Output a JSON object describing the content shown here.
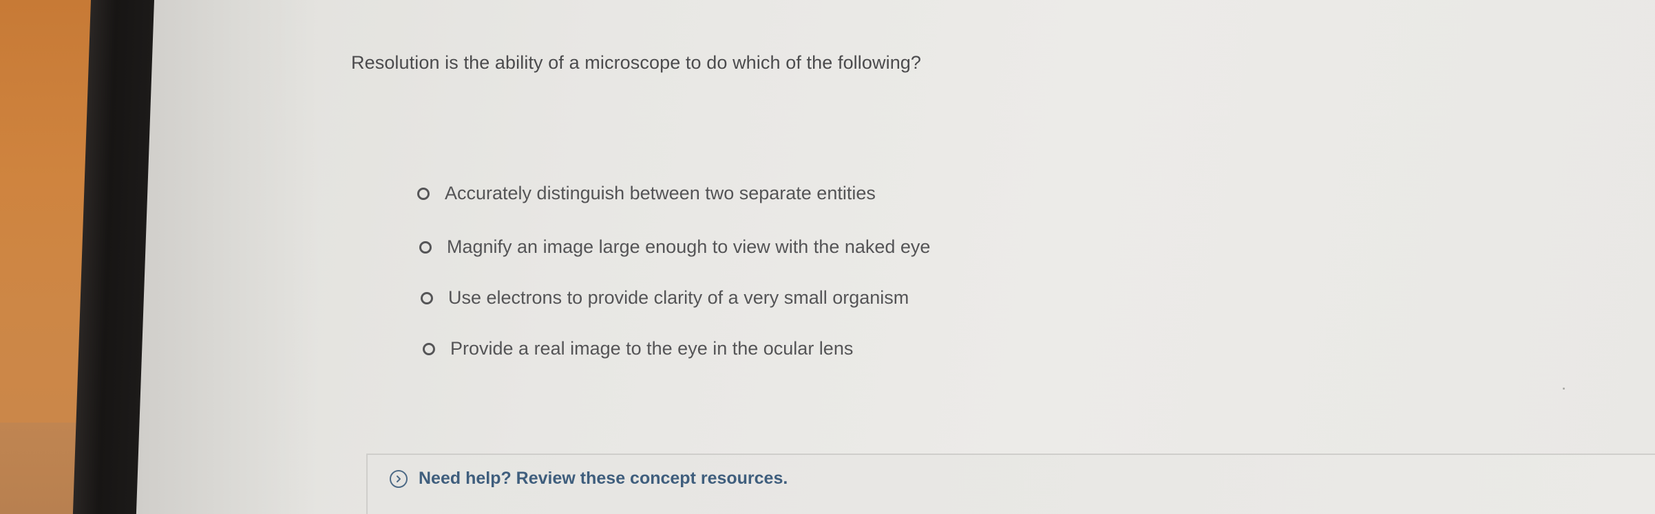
{
  "question": {
    "text": "Resolution is the ability of a microscope to do which of the following?"
  },
  "options": [
    {
      "label": "Accurately distinguish between two separate entities",
      "selected": false
    },
    {
      "label": "Magnify an image large enough to view with the naked eye",
      "selected": false
    },
    {
      "label": "Use electrons to provide clarity of a very small organism",
      "selected": false
    },
    {
      "label": "Provide a real image to the eye in the ocular lens",
      "selected": false
    }
  ],
  "help": {
    "label": "Need help? Review these concept resources.",
    "icon": "chevron-right-circle-icon"
  },
  "colors": {
    "text": "#4b4b4d",
    "link": "#3f5e7d",
    "radio_border": "#555557"
  }
}
